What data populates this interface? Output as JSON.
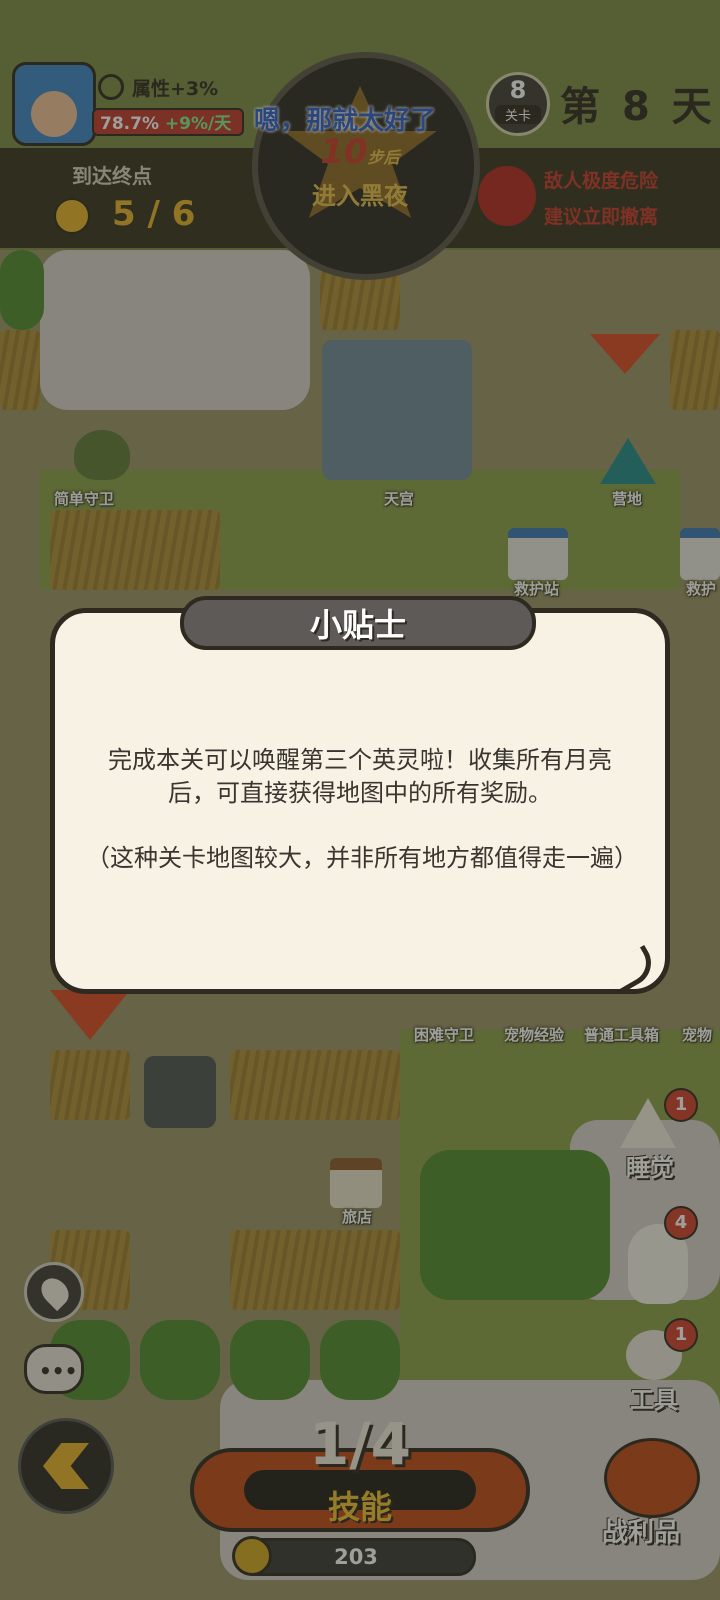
{
  "player": {
    "attr_label": "属性+3%",
    "progress_pct": "78.7%",
    "progress_rate": "+9%/天"
  },
  "dialog": {
    "line": "嗯，那就太好了"
  },
  "level": {
    "number": "8",
    "label": "关卡"
  },
  "day": {
    "prefix": "第",
    "number": "8",
    "suffix": "天"
  },
  "goal": {
    "label": "到达终点",
    "current": "5",
    "total": "6"
  },
  "night_warning": {
    "steps": "10",
    "steps_unit": "步后",
    "text": "进入黑夜"
  },
  "enemy_warning": {
    "line1": "敌人极度危险",
    "line2": "建议立即撤离"
  },
  "map_labels": {
    "simple_guard": "简单守卫",
    "heaven_palace": "天宫",
    "camp": "营地",
    "rescue_station": "救护站",
    "rescue_station_2": "救护",
    "hard_guard": "困难守卫",
    "pet_exp": "宠物经验",
    "toolbox": "普通工具箱",
    "pet": "宠物",
    "inn": "旅店"
  },
  "tip_modal": {
    "title": "小贴士",
    "para1": "完成本关可以唤醒第三个英灵啦！收集所有月亮后，可直接获得地图中的所有奖励。",
    "para2": "（这种关卡地图较大，并非所有地方都值得走一遍）"
  },
  "side_buttons": {
    "sleep": {
      "label": "睡觉",
      "badge": "1"
    },
    "move_badge": "4",
    "tools": {
      "label": "工具",
      "badge": "1"
    },
    "loot": {
      "label": "战利品"
    }
  },
  "skill": {
    "count": "1/4",
    "label": "技能"
  },
  "coins": {
    "value": "203"
  }
}
